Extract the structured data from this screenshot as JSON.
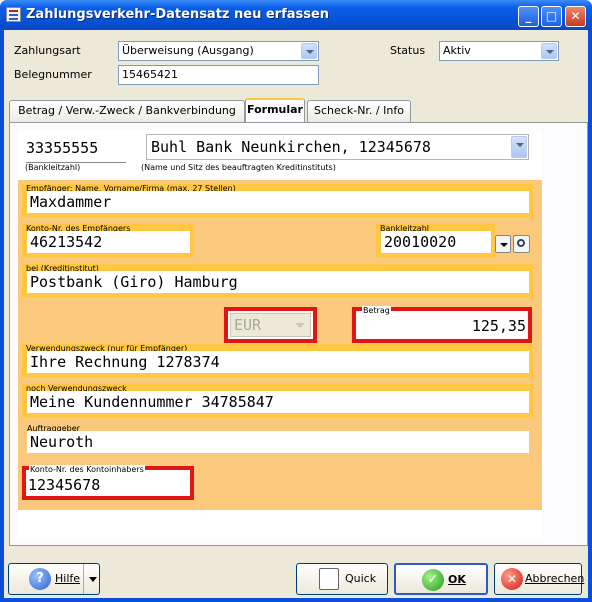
{
  "window": {
    "title": "Zahlungsverkehr-Datensatz neu erfassen",
    "minimize": "_",
    "maximize": "□",
    "close": "✕"
  },
  "header": {
    "zahlungsart_label": "Zahlungsart",
    "zahlungsart_value": "Überweisung (Ausgang)",
    "status_label": "Status",
    "status_value": "Aktiv",
    "belegnummer_label": "Belegnummer",
    "belegnummer_value": "15465421"
  },
  "tabs": [
    {
      "label": "Betrag / Verw.-Zweck / Bankverbindung"
    },
    {
      "label": "Formular"
    },
    {
      "label": "Scheck-Nr. / Info"
    }
  ],
  "form": {
    "blz_top": "33355555",
    "blz_top_caption": "(Bankleitzahl)",
    "bank_name": "Buhl Bank Neunkirchen, 12345678",
    "bank_caption": "(Name und Sitz des beauftragten Kreditinstituts)",
    "empfaenger_label": "Empfänger: Name, Vorname/Firma (max. 27 Stellen)",
    "empfaenger_value": "Maxdammer",
    "konto_empf_label": "Konto-Nr. des Empfängers",
    "konto_empf_value": "46213542",
    "bankleitzahl_label": "Bankleitzahl",
    "bankleitzahl_value": "20010020",
    "bei_label": "bei (Kreditinstitut)",
    "bei_value": "Postbank (Giro) Hamburg",
    "currency_value": "EUR",
    "betrag_label": "Betrag",
    "betrag_value": "125,35",
    "verwendung_label": "Verwendungszweck (nur für Empfänger)",
    "verwendung_value": "Ihre Rechnung 1278374",
    "noch_label": "noch Verwendungszweck",
    "noch_value": "Meine Kundennummer 34785847",
    "auftraggeber_label": "Auftraggeber",
    "auftraggeber_value": "Neuroth",
    "konto_inhaber_label": "Konto-Nr. des Kontoinhabers",
    "konto_inhaber_value": "12345678"
  },
  "footer": {
    "hilfe": "Hilfe",
    "quick": "Quick",
    "ok": "OK",
    "abbrechen": "Abbrechen"
  }
}
